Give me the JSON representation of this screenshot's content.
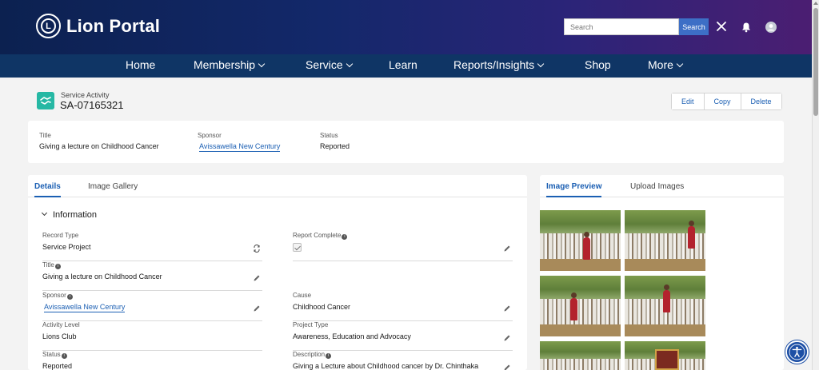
{
  "header": {
    "brand": "Lion Portal",
    "logo_text": "L",
    "search_placeholder": "Search",
    "search_button": "Search"
  },
  "nav": [
    {
      "label": "Home",
      "dropdown": false
    },
    {
      "label": "Membership",
      "dropdown": true
    },
    {
      "label": "Service",
      "dropdown": true
    },
    {
      "label": "Learn",
      "dropdown": false
    },
    {
      "label": "Reports/Insights",
      "dropdown": true
    },
    {
      "label": "Shop",
      "dropdown": false
    },
    {
      "label": "More",
      "dropdown": true
    }
  ],
  "record": {
    "object_label": "Service Activity",
    "id": "SA-07165321",
    "actions": {
      "edit": "Edit",
      "copy": "Copy",
      "delete": "Delete"
    }
  },
  "highlights": {
    "title_label": "Title",
    "title_value": "Giving a lecture on Childhood Cancer",
    "sponsor_label": "Sponsor",
    "sponsor_value": "Avissawella New Century",
    "status_label": "Status",
    "status_value": "Reported"
  },
  "details": {
    "tabs": {
      "details": "Details",
      "gallery": "Image Gallery"
    },
    "section_title": "Information",
    "record_type_label": "Record Type",
    "record_type_value": "Service Project",
    "report_complete_label": "Report Complete",
    "title_label": "Title",
    "title_value": "Giving a lecture on Childhood Cancer",
    "sponsor_label": "Sponsor",
    "sponsor_value": "Avissawella New Century",
    "cause_label": "Cause",
    "cause_value": "Childhood Cancer",
    "activity_level_label": "Activity Level",
    "activity_level_value": "Lions Club",
    "project_type_label": "Project Type",
    "project_type_value": "Awareness, Education and Advocacy",
    "status_label": "Status",
    "status_value": "Reported",
    "description_label": "Description",
    "description_value": "Giving a Lecture about Childhood cancer by Dr. Chinthaka"
  },
  "images": {
    "tabs": {
      "preview": "Image Preview",
      "upload": "Upload Images"
    }
  },
  "colors": {
    "nav_bg": "#0f3565",
    "link": "#1b5fb3",
    "record_icon": "#26b8a4"
  }
}
